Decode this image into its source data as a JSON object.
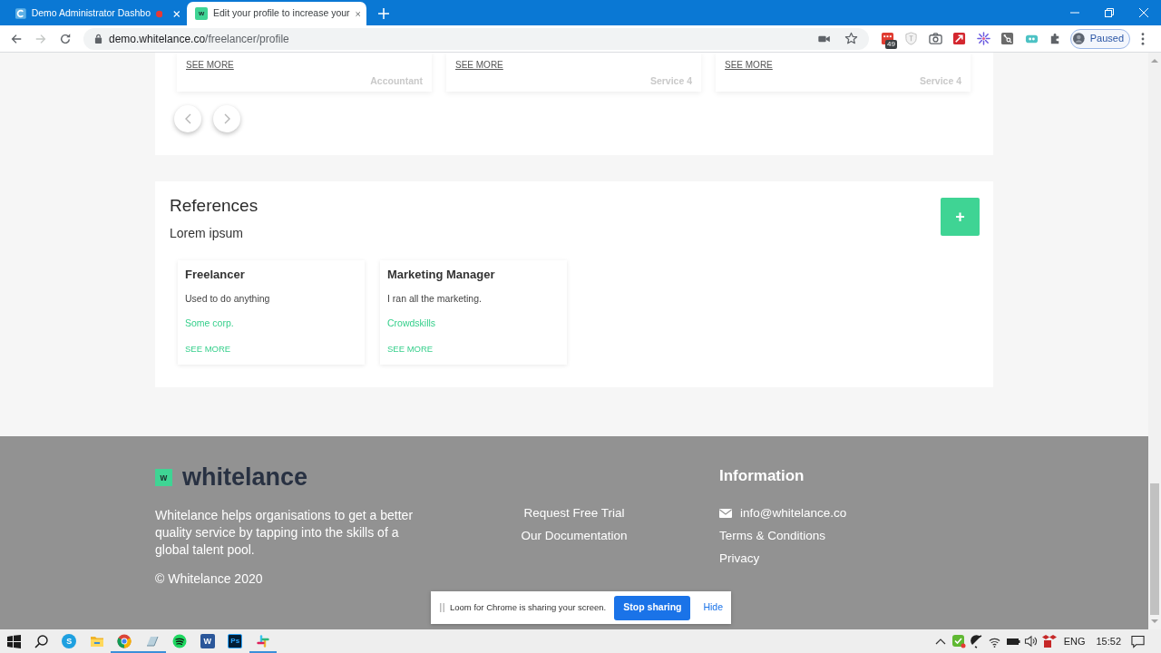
{
  "browser": {
    "tabs": [
      {
        "title": "Demo Administrator Dashbo",
        "selected": false,
        "recording": true
      },
      {
        "title": "Edit your profile to increase your",
        "selected": true,
        "favicon_text": "w",
        "recording": false
      }
    ],
    "address": {
      "host": "demo.whitelance.co",
      "path": "/freelancer/profile"
    },
    "extension_badge": "49",
    "profile": "Paused"
  },
  "page": {
    "carousel_cards": [
      {
        "link": "SEE MORE",
        "label": "Accountant"
      },
      {
        "link": "SEE MORE",
        "label": "Service 4"
      },
      {
        "link": "SEE MORE",
        "label": "Service 4"
      }
    ],
    "references": {
      "title": "References",
      "subtitle": "Lorem ipsum",
      "add_button": "+",
      "cards": [
        {
          "title": "Freelancer",
          "description": "Used to do anything",
          "company": "Some corp.",
          "link": "SEE MORE"
        },
        {
          "title": "Marketing Manager",
          "description": "I ran all the marketing.",
          "company": "Crowdskills",
          "link": "SEE MORE"
        }
      ]
    }
  },
  "footer": {
    "logo": {
      "mark": "w",
      "name": "whitelance"
    },
    "about": "Whitelance helps organisations to get a better quality service by tapping into the skills of a global talent pool.",
    "copyright": "© Whitelance 2020",
    "links": [
      "Request Free Trial",
      "Our Documentation"
    ],
    "information": {
      "title": "Information",
      "email": "info@whitelance.co",
      "links": [
        "Terms & Conditions",
        "Privacy"
      ]
    }
  },
  "loom_bar": {
    "message": "Loom for Chrome is sharing your screen.",
    "stop_button": "Stop sharing",
    "hide_link": "Hide"
  },
  "taskbar": {
    "apps": [
      {
        "kind": "skype",
        "label": "S",
        "running": false
      },
      {
        "kind": "folder",
        "running": false
      },
      {
        "kind": "chrome",
        "running": true
      },
      {
        "kind": "paper",
        "running": true
      },
      {
        "kind": "spotify",
        "running": false
      },
      {
        "kind": "word",
        "label": "W",
        "running": false
      },
      {
        "kind": "photoshop",
        "label": "Ps",
        "running": false
      },
      {
        "kind": "slack",
        "running": true
      }
    ],
    "language": "ENG",
    "time": "15:52"
  }
}
